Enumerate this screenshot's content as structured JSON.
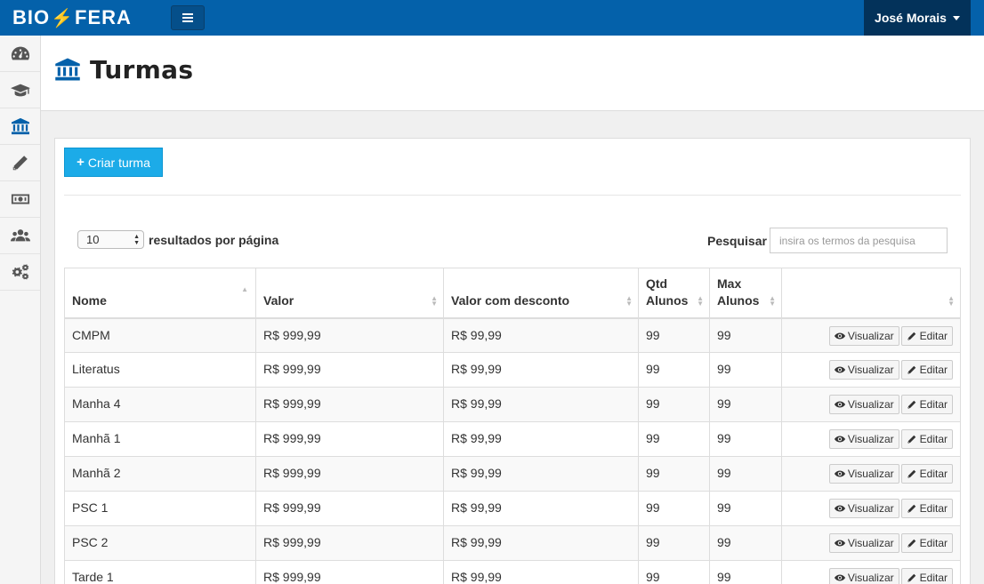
{
  "brand": {
    "left": "BIO",
    "right": "FERA"
  },
  "user": {
    "name": "José Morais"
  },
  "page": {
    "title": "Turmas"
  },
  "toolbar": {
    "create_label": "Criar turma",
    "create_icon": "plus-icon"
  },
  "listing": {
    "page_size": "10",
    "page_size_label": "resultados por página",
    "search_label": "Pesquisar",
    "search_placeholder": "insira os termos da pesquisa"
  },
  "table": {
    "columns": [
      "Nome",
      "Valor",
      "Valor com desconto",
      "Qtd Alunos",
      "Max Alunos",
      ""
    ],
    "view_label": "Visualizar",
    "edit_label": "Editar",
    "rows": [
      {
        "nome": "CMPM",
        "valor": "R$ 999,99",
        "desconto": "R$ 99,99",
        "qtd": "99",
        "max": "99"
      },
      {
        "nome": "Literatus",
        "valor": "R$ 999,99",
        "desconto": "R$ 99,99",
        "qtd": "99",
        "max": "99"
      },
      {
        "nome": "Manha 4",
        "valor": "R$ 999,99",
        "desconto": "R$ 99,99",
        "qtd": "99",
        "max": "99"
      },
      {
        "nome": "Manhã 1",
        "valor": "R$ 999,99",
        "desconto": "R$ 99,99",
        "qtd": "99",
        "max": "99"
      },
      {
        "nome": "Manhã 2",
        "valor": "R$ 999,99",
        "desconto": "R$ 99,99",
        "qtd": "99",
        "max": "99"
      },
      {
        "nome": "PSC 1",
        "valor": "R$ 999,99",
        "desconto": "R$ 99,99",
        "qtd": "99",
        "max": "99"
      },
      {
        "nome": "PSC 2",
        "valor": "R$ 999,99",
        "desconto": "R$ 99,99",
        "qtd": "99",
        "max": "99"
      },
      {
        "nome": "Tarde 1",
        "valor": "R$ 999,99",
        "desconto": "R$ 99,99",
        "qtd": "99",
        "max": "99"
      }
    ]
  },
  "sidebar": {
    "items": [
      {
        "icon": "dashboard-icon",
        "active": false
      },
      {
        "icon": "graduation-cap-icon",
        "active": false
      },
      {
        "icon": "institution-icon",
        "active": true
      },
      {
        "icon": "pencil-icon",
        "active": false
      },
      {
        "icon": "money-icon",
        "active": false
      },
      {
        "icon": "users-icon",
        "active": false
      },
      {
        "icon": "cogs-icon",
        "active": false
      }
    ]
  },
  "colors": {
    "brand": "#0461aa",
    "accent": "#1cabe8",
    "bolt": "#f26b21"
  }
}
